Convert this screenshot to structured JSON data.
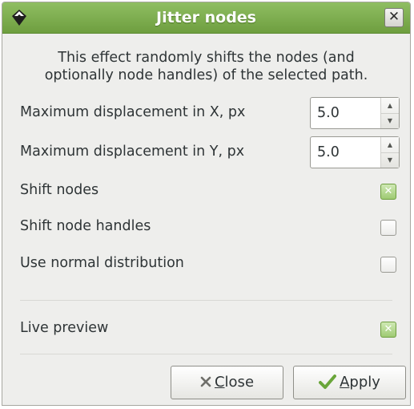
{
  "window": {
    "title": "Jitter nodes",
    "close_glyph": "✕"
  },
  "description": {
    "line1": "This effect randomly shifts the nodes (and",
    "line2": "optionally node handles) of the selected path."
  },
  "fields": {
    "max_x": {
      "label": "Maximum displacement in X, px",
      "value": "5.0"
    },
    "max_y": {
      "label": "Maximum displacement in Y, px",
      "value": "5.0"
    }
  },
  "options": {
    "shift_nodes": {
      "label": "Shift nodes",
      "checked": true
    },
    "shift_node_handles": {
      "label": "Shift node handles",
      "checked": false
    },
    "use_normal_distribution": {
      "label": "Use normal distribution",
      "checked": false
    },
    "live_preview": {
      "label": "Live preview",
      "checked": true
    }
  },
  "buttons": {
    "close": {
      "mnemonic": "C",
      "rest": "lose",
      "icon": "x-icon"
    },
    "apply": {
      "mnemonic": "A",
      "rest": "pply",
      "icon": "checkmark-icon"
    }
  },
  "colors": {
    "titlebar": "#7aab4a",
    "check_accent": "#9fcb73",
    "apply_icon": "#6aa63a"
  }
}
